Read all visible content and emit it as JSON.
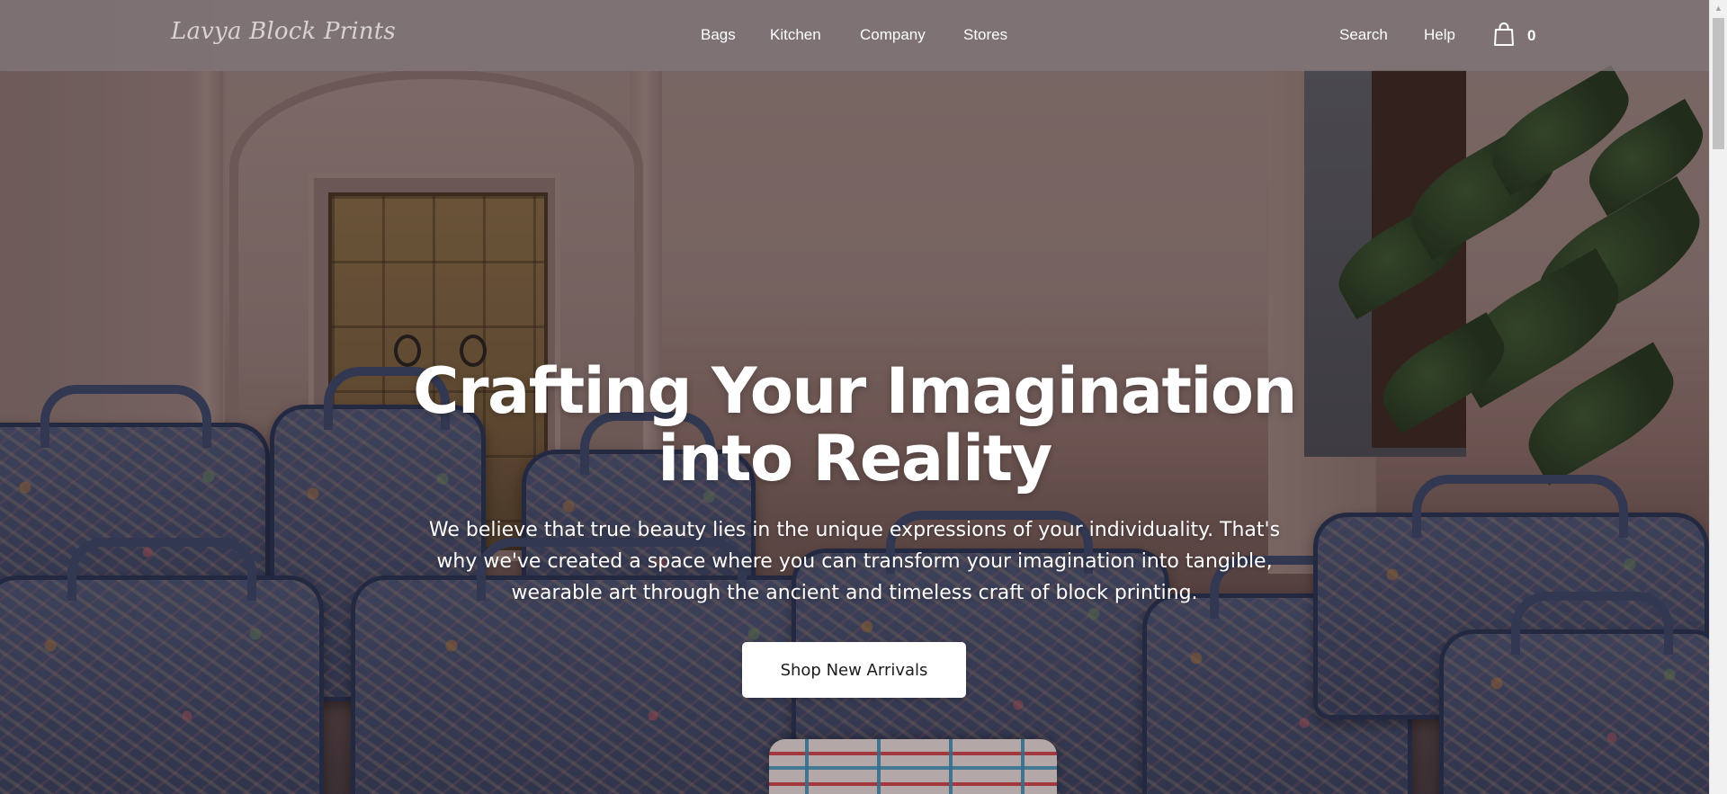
{
  "brand": {
    "logo_text": "Lavya Block Prints"
  },
  "nav": {
    "left_items": [
      {
        "label": "Bags"
      },
      {
        "label": "Kitchen"
      },
      {
        "label": "Company"
      },
      {
        "label": "Stores"
      }
    ],
    "right_items": [
      {
        "label": "Search"
      },
      {
        "label": "Help"
      }
    ],
    "cart": {
      "icon": "shopping-bag-icon",
      "count": "0"
    }
  },
  "hero": {
    "title_line1": "Crafting Your Imagination",
    "title_line2": "into Reality",
    "subtitle": "We believe that true beauty lies in the unique expressions of your individuality. That's why we've created a space where you can transform your imagination into tangible, wearable art through the ancient and timeless craft of block printing.",
    "cta_label": "Shop New Arrivals"
  },
  "colors": {
    "header_bg": "#80767a",
    "cta_bg": "#ffffff",
    "text_light": "#ffffff"
  }
}
